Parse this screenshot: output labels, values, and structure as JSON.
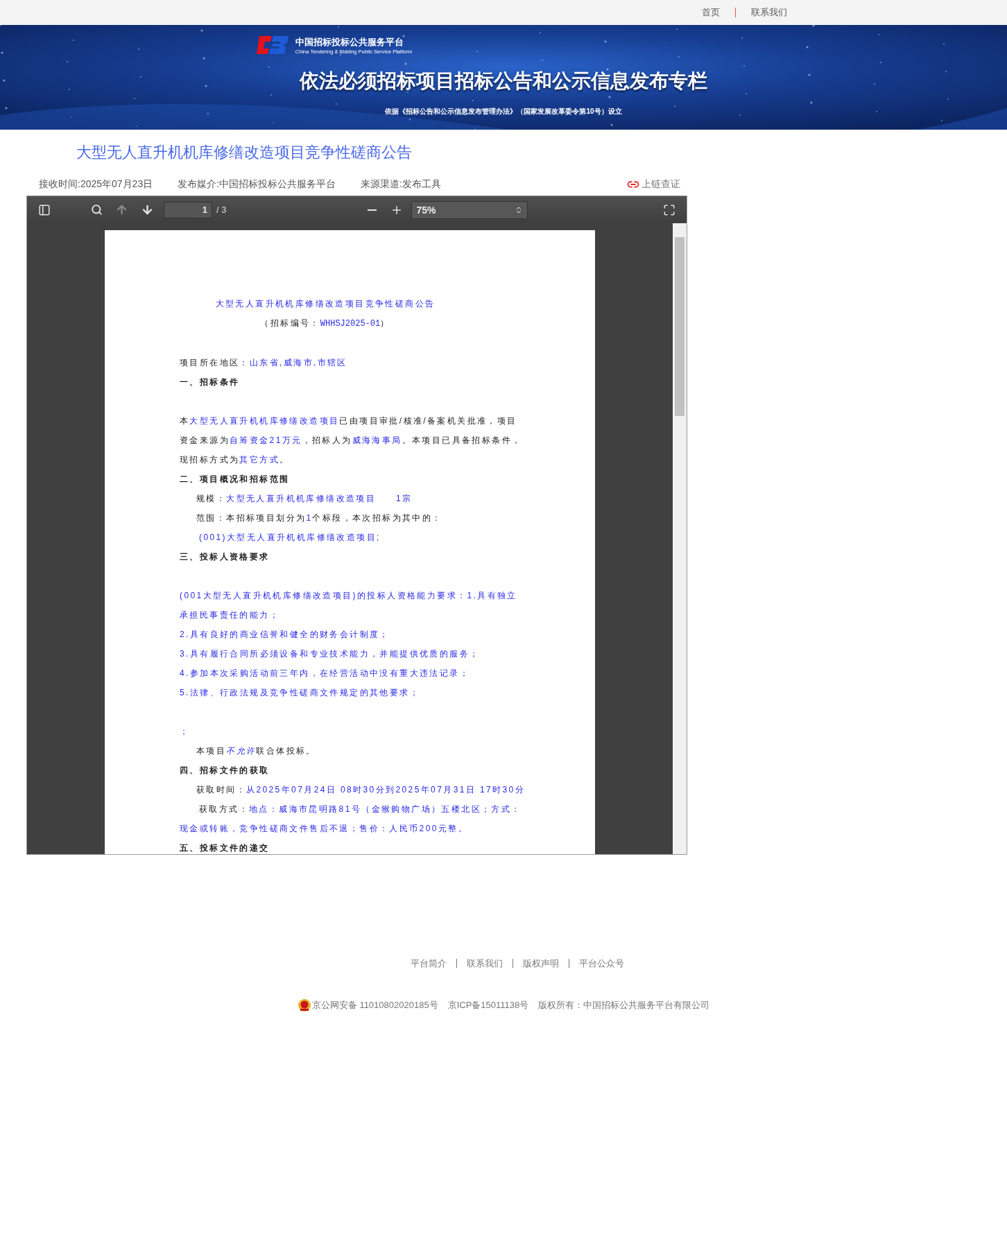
{
  "top_nav": {
    "links": [
      "首页",
      "联系我们"
    ]
  },
  "banner": {
    "logo_title": "中国招标投标公共服务平台",
    "logo_subtitle": "China Tendering & Bidding Public Service Platform",
    "title": "依法必须招标项目招标公告和公示信息发布专栏",
    "note": "依据《招标公告和公示信息发布管理办法》（国家发展改革委令第10号）设立"
  },
  "page_title": "大型无人直升机机库修缮改造项目竞争性磋商公告",
  "meta": [
    "接收时间:2025年07月23日",
    "发布媒介:中国招标投标公共服务平台",
    "来源渠道:发布工具"
  ],
  "chain_link": "上链查证",
  "viewer": {
    "toolbar": {
      "prev_page": {
        "disabled": true
      },
      "next_page": {
        "disabled": false
      },
      "page_value": "1",
      "page_count": "/ 3",
      "zoom": "75%"
    },
    "lines": [
      {
        "kind": "title",
        "spaced": false,
        "parts": [
          {
            "kind": "field",
            "text": "大型无人直升机机库修缮改造项目竞争性磋商公告"
          }
        ]
      },
      {
        "kind": "center",
        "spaced": false,
        "parts": [
          {
            "kind": "plain",
            "text": "（招标编号："
          },
          {
            "kind": "code",
            "text": "WHHSJ2025-01"
          },
          {
            "kind": "plain",
            "text": "）"
          }
        ]
      },
      {
        "kind": "body",
        "spaced": true,
        "parts": [
          {
            "kind": "plain",
            "text": "项目所在地区："
          },
          {
            "kind": "field",
            "text": "山东省,威海市,市辖区"
          }
        ]
      },
      {
        "kind": "heading",
        "spaced": false,
        "parts": [
          {
            "kind": "plain",
            "text": "一、招标条件"
          }
        ]
      },
      {
        "kind": "body",
        "spaced": true,
        "parts": [
          {
            "kind": "plain",
            "text": "本"
          },
          {
            "kind": "field",
            "text": "大型无人直升机机库修缮改造项目"
          },
          {
            "kind": "plain",
            "text": "已由项目审批/核准/备案机关批准，项目资金来源为"
          },
          {
            "kind": "field",
            "text": "自筹资金21万元"
          },
          {
            "kind": "plain",
            "text": "，招标人为"
          },
          {
            "kind": "field",
            "text": "威海海事局"
          },
          {
            "kind": "plain",
            "text": "。本项目已具备招标条件，现招标方式为"
          },
          {
            "kind": "field",
            "text": "其它方式"
          },
          {
            "kind": "plain",
            "text": "。"
          }
        ]
      },
      {
        "kind": "heading",
        "spaced": false,
        "parts": [
          {
            "kind": "plain",
            "text": "二、项目概况和招标范围"
          }
        ]
      },
      {
        "kind": "indent",
        "spaced": false,
        "parts": [
          {
            "kind": "plain",
            "text": "规模："
          },
          {
            "kind": "field",
            "text": "大型无人直升机机库修缮改造项目　　1宗"
          }
        ]
      },
      {
        "kind": "indent",
        "spaced": false,
        "parts": [
          {
            "kind": "plain",
            "text": "范围：本招标项目划分为"
          },
          {
            "kind": "field",
            "text": "1"
          },
          {
            "kind": "plain",
            "text": "个标段，本次招标为其中的："
          }
        ]
      },
      {
        "kind": "indent_wide",
        "spaced": false,
        "parts": [
          {
            "kind": "field",
            "text": "(001)大型无人直升机机库修缮改造项目;"
          }
        ]
      },
      {
        "kind": "heading",
        "spaced": false,
        "parts": [
          {
            "kind": "plain",
            "text": "三、投标人资格要求"
          }
        ]
      },
      {
        "kind": "body",
        "spaced": true,
        "parts": [
          {
            "kind": "field",
            "text": "(001大型无人直升机机库修缮改造项目)的投标人资格能力要求：1.具有独立承担民事责任的能力；"
          }
        ]
      },
      {
        "kind": "body",
        "spaced": false,
        "parts": [
          {
            "kind": "field",
            "text": "2.具有良好的商业信誉和健全的财务会计制度；"
          }
        ]
      },
      {
        "kind": "body",
        "spaced": false,
        "parts": [
          {
            "kind": "field",
            "text": "3.具有履行合同所必须设备和专业技术能力，并能提供优质的服务；"
          }
        ]
      },
      {
        "kind": "body",
        "spaced": false,
        "parts": [
          {
            "kind": "field",
            "text": "4.参加本次采购活动前三年内，在经营活动中没有重大违法记录；"
          }
        ]
      },
      {
        "kind": "body",
        "spaced": false,
        "parts": [
          {
            "kind": "field",
            "text": "5.法律、行政法规及竞争性磋商文件规定的其他要求；"
          }
        ]
      },
      {
        "kind": "body",
        "spaced": true,
        "parts": [
          {
            "kind": "field",
            "text": "；"
          }
        ]
      },
      {
        "kind": "indent",
        "spaced": false,
        "parts": [
          {
            "kind": "plain",
            "text": "本项目"
          },
          {
            "kind": "field_italic",
            "text": "不允许"
          },
          {
            "kind": "plain",
            "text": "联合体投标。"
          }
        ]
      },
      {
        "kind": "heading",
        "spaced": false,
        "parts": [
          {
            "kind": "plain",
            "text": "四、招标文件的获取"
          }
        ]
      },
      {
        "kind": "indent",
        "spaced": false,
        "parts": [
          {
            "kind": "plain",
            "text": "获取时间："
          },
          {
            "kind": "field",
            "text": "从2025年07月24日 08时30分到2025年07月31日 17时30分"
          }
        ]
      },
      {
        "kind": "hanging",
        "spaced": false,
        "parts": [
          {
            "kind": "plain",
            "text": "获取方式："
          },
          {
            "kind": "field",
            "text": "地点：威海市昆明路81号（金猴购物广场）五楼北区；方式：现金或转账，竞争性磋商文件售后不退；售价：人民币200元整。"
          }
        ]
      },
      {
        "kind": "heading",
        "spaced": false,
        "parts": [
          {
            "kind": "plain",
            "text": "五、投标文件的递交"
          }
        ]
      }
    ]
  },
  "footer": {
    "links": [
      "平台简介",
      "联系我们",
      "版权声明",
      "平台公众号"
    ],
    "records": [
      "京公网安备 11010802020185号",
      "京ICP备15011138号",
      "版权所有：中国招标公共服务平台有限公司"
    ]
  }
}
